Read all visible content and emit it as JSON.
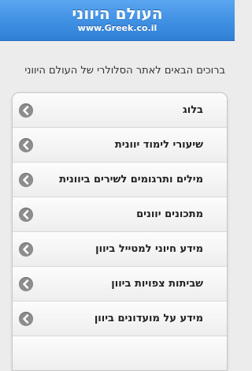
{
  "header": {
    "title": "העולם היווני",
    "url": "www.Greek.co.il"
  },
  "welcome_text": "ברוכים הבאים לאתר הסלולרי של העולם היווני",
  "menu": {
    "items": [
      {
        "label": "בלוג",
        "icon": "chevron-left-icon"
      },
      {
        "label": "שיעורי לימוד יוונית",
        "icon": "chevron-left-icon"
      },
      {
        "label": "מילים ותרגומים לשירים ביוונית",
        "icon": "chevron-left-icon"
      },
      {
        "label": "מתכונים יוונים",
        "icon": "chevron-left-icon"
      },
      {
        "label": "מידע חיוני למטייל ביוון",
        "icon": "chevron-left-icon"
      },
      {
        "label": "שביתות צפויות ביוון",
        "icon": "chevron-left-icon"
      },
      {
        "label": "מידע על מועדונים ביוון",
        "icon": "chevron-left-icon"
      }
    ]
  },
  "colors": {
    "header_blue": "#3f8fe3",
    "arrow_gray": "#8d8d8d"
  }
}
